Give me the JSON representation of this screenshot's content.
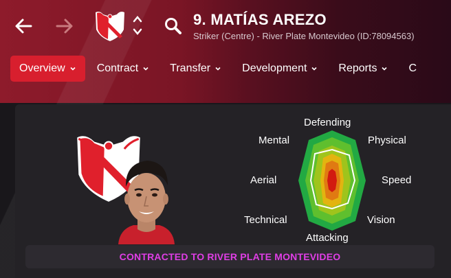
{
  "header": {
    "title": "9. MATÍAS AREZO",
    "subtitle": "Striker (Centre) - River Plate Montevideo (ID:78094563)"
  },
  "icons": {
    "back": "arrow-left-icon",
    "forward": "arrow-right-icon",
    "club_crest": "club-crest-icon",
    "switch_player": "chevron-up-down-icon",
    "search": "search-icon"
  },
  "tabs": [
    {
      "label": "Overview",
      "active": true
    },
    {
      "label": "Contract",
      "active": false
    },
    {
      "label": "Transfer",
      "active": false
    },
    {
      "label": "Development",
      "active": false
    },
    {
      "label": "Reports",
      "active": false
    },
    {
      "label": "C",
      "active": false
    }
  ],
  "radar": {
    "labels": {
      "defending": "Defending",
      "physical": "Physical",
      "speed": "Speed",
      "vision": "Vision",
      "attacking": "Attacking",
      "technical": "Technical",
      "aerial": "Aerial",
      "mental": "Mental"
    }
  },
  "banner": "CONTRACTED TO RIVER PLATE MONTEVIDEO",
  "colors": {
    "accent": "#d81f2e",
    "banner_text": "#e03ee6",
    "radar_outer": "#22a943",
    "radar_inner": "#d21a10"
  }
}
